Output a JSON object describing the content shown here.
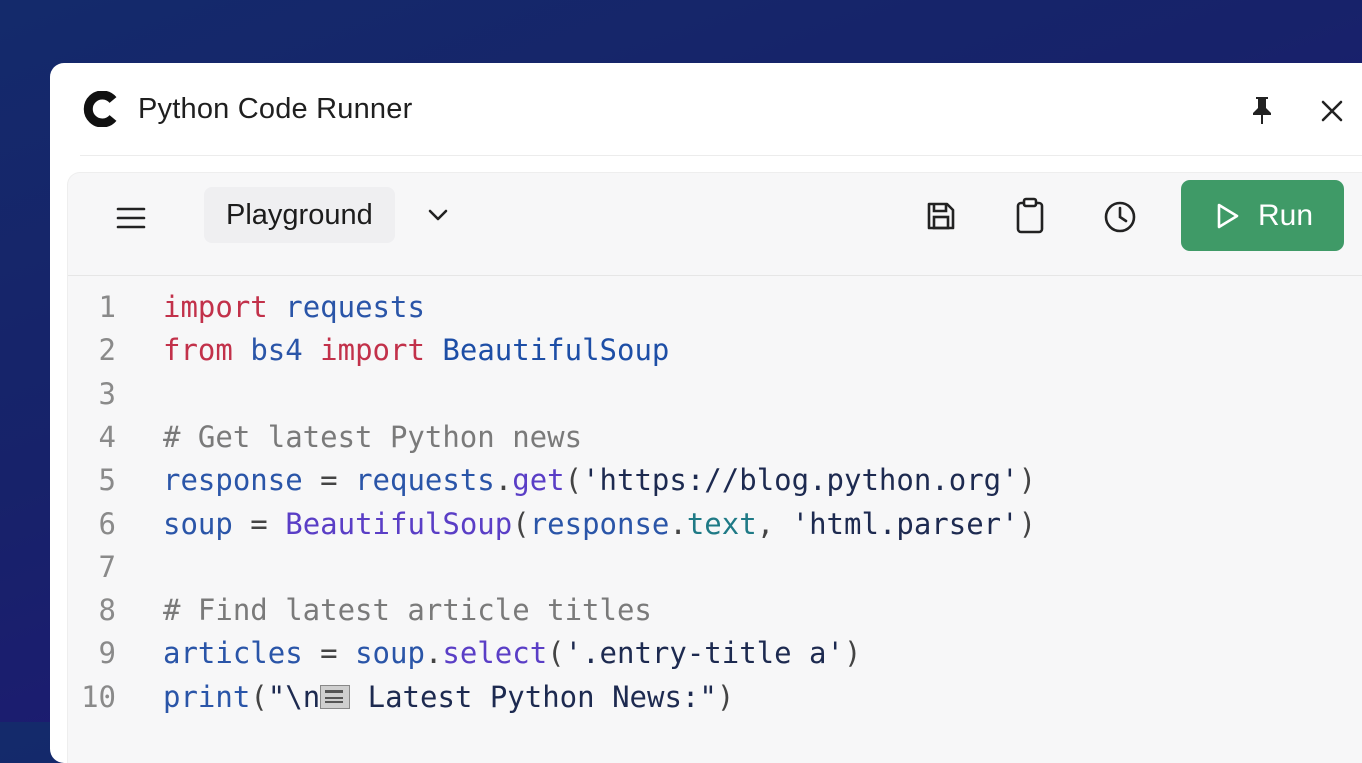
{
  "window": {
    "title": "Python Code Runner",
    "logo_icon": "c-logo-icon",
    "pin_icon": "pin-icon",
    "close_icon": "close-icon"
  },
  "toolbar": {
    "menu_icon": "hamburger-menu-icon",
    "playground_label": "Playground",
    "save_icon": "save-icon",
    "clipboard_icon": "clipboard-icon",
    "history_icon": "history-clock-icon",
    "run_label": "Run"
  },
  "colors": {
    "run_button": "#3f9a67",
    "keyword": "#c2314a",
    "identifier": "#2a55a8",
    "comment": "#7a7a7a"
  },
  "editor": {
    "lines": [
      {
        "n": "1",
        "tokens": [
          [
            "kw",
            "import"
          ],
          [
            "pl",
            " "
          ],
          [
            "id",
            "requests"
          ]
        ]
      },
      {
        "n": "2",
        "tokens": [
          [
            "kw",
            "from"
          ],
          [
            "pl",
            " "
          ],
          [
            "id",
            "bs4"
          ],
          [
            "pl",
            " "
          ],
          [
            "kw",
            "import"
          ],
          [
            "pl",
            " "
          ],
          [
            "cls",
            "BeautifulSoup"
          ]
        ]
      },
      {
        "n": "3",
        "tokens": []
      },
      {
        "n": "4",
        "tokens": [
          [
            "cm",
            "# Get latest Python news"
          ]
        ]
      },
      {
        "n": "5",
        "tokens": [
          [
            "id",
            "response"
          ],
          [
            "pl",
            " = "
          ],
          [
            "id",
            "requests"
          ],
          [
            "pl",
            "."
          ],
          [
            "fn",
            "get"
          ],
          [
            "pl",
            "("
          ],
          [
            "str",
            "'https://blog.python.org'"
          ],
          [
            "pl",
            ")"
          ]
        ]
      },
      {
        "n": "6",
        "tokens": [
          [
            "id",
            "soup"
          ],
          [
            "pl",
            " = "
          ],
          [
            "fn",
            "BeautifulSoup"
          ],
          [
            "pl",
            "("
          ],
          [
            "id",
            "response"
          ],
          [
            "pl",
            "."
          ],
          [
            "attr",
            "text"
          ],
          [
            "pl",
            ", "
          ],
          [
            "str",
            "'html.parser'"
          ],
          [
            "pl",
            ")"
          ]
        ]
      },
      {
        "n": "7",
        "tokens": []
      },
      {
        "n": "8",
        "tokens": [
          [
            "cm",
            "# Find latest article titles"
          ]
        ]
      },
      {
        "n": "9",
        "tokens": [
          [
            "id",
            "articles"
          ],
          [
            "pl",
            " = "
          ],
          [
            "id",
            "soup"
          ],
          [
            "pl",
            "."
          ],
          [
            "fn",
            "select"
          ],
          [
            "pl",
            "("
          ],
          [
            "str",
            "'.entry-title a'"
          ],
          [
            "pl",
            ")"
          ]
        ]
      },
      {
        "n": "10",
        "tokens": [
          [
            "id",
            "print"
          ],
          [
            "pl",
            "("
          ],
          [
            "str",
            "\"\\n"
          ],
          [
            "emoji",
            "newspaper"
          ],
          [
            "str",
            " Latest Python News:\""
          ],
          [
            "pl",
            ")"
          ]
        ]
      }
    ]
  }
}
